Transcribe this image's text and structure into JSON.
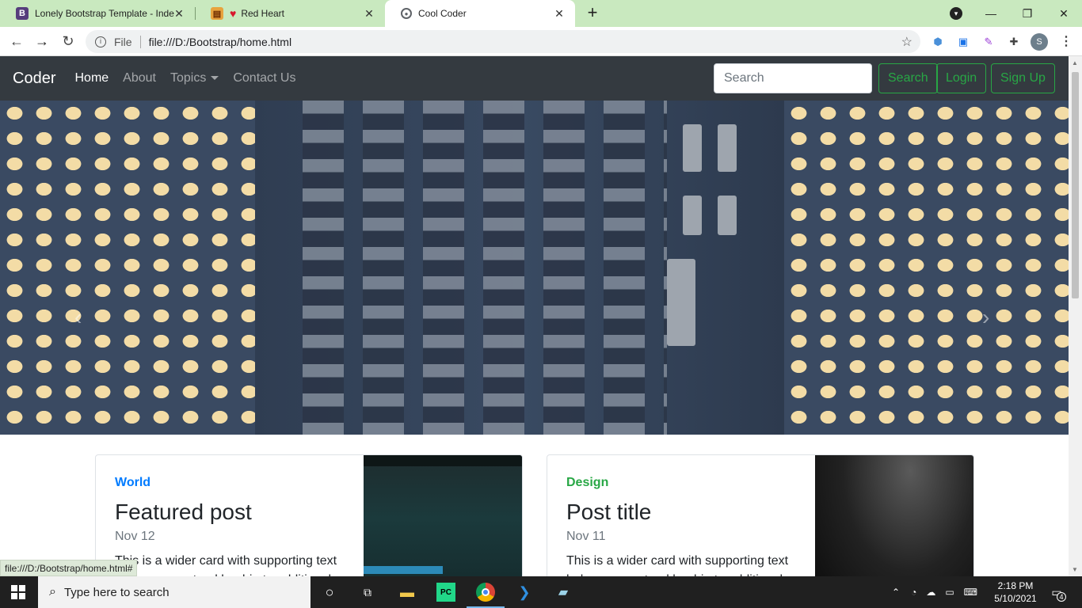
{
  "browser": {
    "tabs": [
      {
        "title": "Lonely Bootstrap Template - Inde",
        "favicon": "B",
        "active": false
      },
      {
        "title": "Red Heart",
        "favicon": "heart",
        "active": false
      },
      {
        "title": "Cool Coder",
        "favicon": "globe",
        "active": true
      }
    ],
    "address_scheme": "File",
    "address_url": "file:///D:/Bootstrap/home.html",
    "profile_initial": "S",
    "status_url": "file:///D:/Bootstrap/home.html#"
  },
  "navbar": {
    "brand": "Coder",
    "links": [
      "Home",
      "About",
      "Topics",
      "Contact Us"
    ],
    "search_placeholder": "Search",
    "buttons": {
      "search": "Search",
      "login": "Login",
      "signup": "Sign Up"
    }
  },
  "cards": [
    {
      "category": "World",
      "category_color": "#007bff",
      "title": "Featured post",
      "date": "Nov 12",
      "text": "This is a wider card with supporting text below as a natural lead-in to additional"
    },
    {
      "category": "Design",
      "category_color": "#28a745",
      "title": "Post title",
      "date": "Nov 11",
      "text": "This is a wider card with supporting text below as a natural lead-in to additional"
    }
  ],
  "taskbar": {
    "search_placeholder": "Type here to search",
    "time": "2:18 PM",
    "date": "5/10/2021",
    "notifications": "4"
  },
  "colors": {
    "navbar_bg": "#343a40",
    "success": "#28a745",
    "primary": "#007bff",
    "tabstrip": "#c9e9bf"
  }
}
